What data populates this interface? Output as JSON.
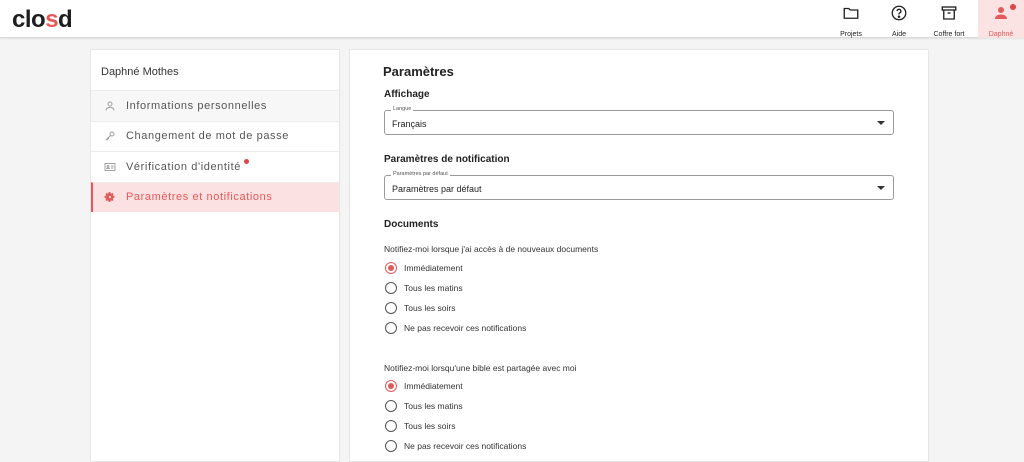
{
  "app": {
    "logo_prefix": "clo",
    "logo_accent": "s",
    "logo_suffix": "d"
  },
  "topnav": {
    "items": [
      {
        "label": "Projets",
        "icon": "folder-icon"
      },
      {
        "label": "Aide",
        "icon": "help-icon"
      },
      {
        "label": "Coffre fort",
        "icon": "archive-icon"
      },
      {
        "label": "Daphné",
        "icon": "user-icon"
      }
    ]
  },
  "sidebar": {
    "user_name": "Daphné Mothes",
    "items": [
      {
        "label": "Informations personnelles",
        "icon": "user-icon"
      },
      {
        "label": "Changement de mot de passe",
        "icon": "key-icon"
      },
      {
        "label": "Vérification d'identité",
        "icon": "id-card-icon"
      },
      {
        "label": "Paramètres et notifications",
        "icon": "gear-icon"
      }
    ]
  },
  "main": {
    "title": "Paramètres",
    "display_section": "Affichage",
    "language_label": "Langue",
    "language_value": "Français",
    "notif_section": "Paramètres de notification",
    "notif_label": "Paramètres par défaut",
    "notif_value": "Paramètres par défaut",
    "documents_section": "Documents",
    "q1": "Notifiez-moi lorsque j'ai accès à de nouveaux documents",
    "q2": "Notifiez-moi lorsqu'une bible est partagée avec moi",
    "options": [
      "Immédiatement",
      "Tous les matins",
      "Tous les soirs",
      "Ne pas recevoir ces notifications"
    ],
    "q1_selected": "Immédiatement",
    "q2_selected": "Immédiatement"
  },
  "colors": {
    "accent": "#e45a5a",
    "active_bg": "#fbe1e1",
    "badge": "#e04444"
  }
}
